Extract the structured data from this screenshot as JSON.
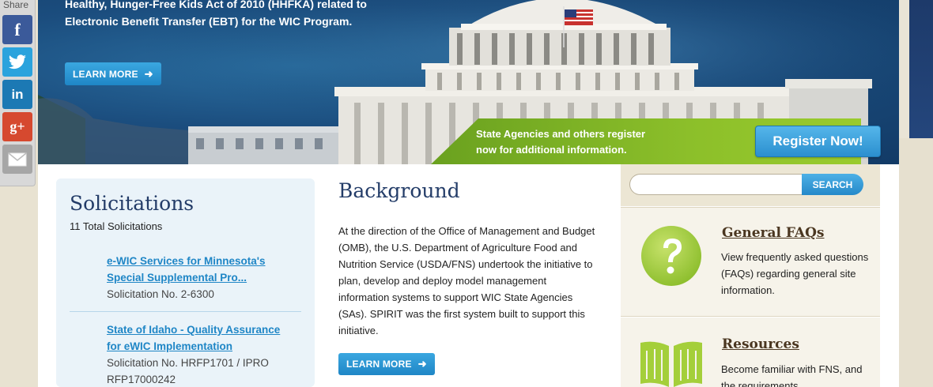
{
  "share": {
    "label": "Share",
    "buttons": [
      {
        "name": "facebook",
        "glyph": "f",
        "color": "#3b5a9a"
      },
      {
        "name": "twitter",
        "color": "#2aa3dd"
      },
      {
        "name": "linkedin",
        "glyph": "in",
        "color": "#1c79b4"
      },
      {
        "name": "google-plus",
        "glyph": "g+",
        "color": "#d6492f"
      },
      {
        "name": "email",
        "color": "#a6a6a6"
      }
    ]
  },
  "hero": {
    "text_line1": "Healthy, Hunger-Free Kids Act of 2010 (HHFKA) related to",
    "text_line2": "Electronic Benefit Transfer (EBT) for the WIC Program.",
    "learn_more_label": "LEARN MORE",
    "register_text_line1": "State Agencies and others register",
    "register_text_line2": "now for additional information.",
    "register_button_label": "Register Now!"
  },
  "solicitations": {
    "title": "Solicitations",
    "count": "11 Total Solicitations",
    "items": [
      {
        "title_line1": "e-WIC Services for Minnesota's",
        "title_line2": "Special Supplemental Pro...",
        "number": "Solicitation No. 2-6300"
      },
      {
        "title_line1": "State of Idaho - Quality Assurance",
        "title_line2": "for eWIC Implementation",
        "number_line1": "Solicitation No. HRFP1701 / IPRO",
        "number_line2": "RFP17000242"
      }
    ]
  },
  "background": {
    "title": "Background",
    "body": "At the direction of the Office of Management and Budget (OMB), the U.S. Department of Agriculture Food and Nutrition Service (USDA/FNS) undertook the initiative to plan, develop and deploy model management information systems to support WIC State Agencies (SAs). SPIRIT was the first system built to support this initiative.",
    "learn_more_label": "LEARN MORE"
  },
  "search": {
    "placeholder": "",
    "button_label": "SEARCH"
  },
  "faq": {
    "title": "General FAQs",
    "body": "View frequently asked questions (FAQs) regarding general site information."
  },
  "resources": {
    "title": "Resources",
    "body": "Become familiar with FNS, and the requirements"
  },
  "colors": {
    "navy": "#233c68",
    "link_blue": "#1f86c6",
    "green": "#8cbf2a",
    "title_brown": "#4a3620"
  }
}
